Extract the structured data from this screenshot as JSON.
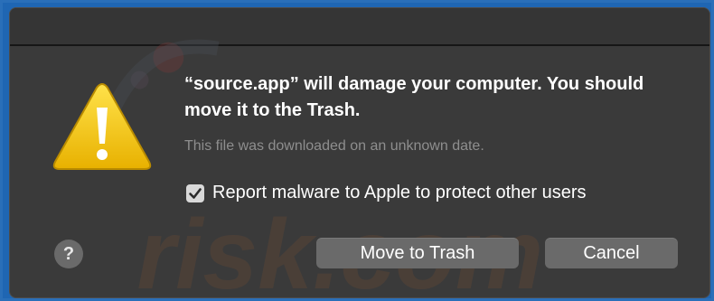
{
  "dialog": {
    "headline": "“source.app” will damage your computer. You should move it to the Trash.",
    "subtext": "This file was downloaded on an unknown date.",
    "report_checkbox": {
      "label": "Report malware to Apple to protect other users",
      "checked": true
    },
    "buttons": {
      "help_label": "?",
      "move_to_trash_label": "Move to Trash",
      "cancel_label": "Cancel"
    }
  },
  "watermark": {
    "text": "risk.com"
  },
  "colors": {
    "background": "#1f66b3",
    "dialog": "#3a3a3a",
    "button": "#6a6a6a",
    "warning_yellow": "#f2c418"
  },
  "icons": {
    "alert": "warning-triangle-icon",
    "checkbox": "checkmark-icon",
    "help": "question-mark-icon"
  }
}
